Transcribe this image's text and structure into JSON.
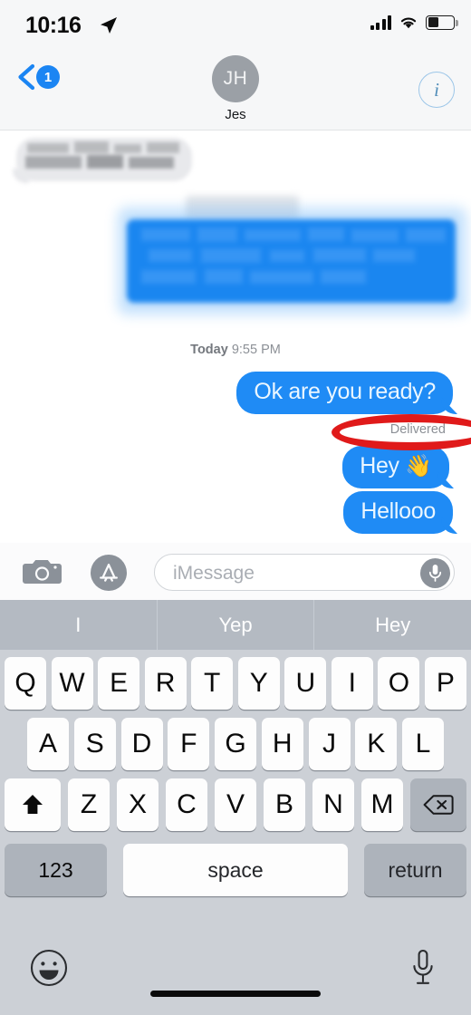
{
  "status_bar": {
    "time": "10:16",
    "location_icon": "location-arrow-icon",
    "signal_icon": "cellular-signal-icon",
    "signal_bars": 4,
    "wifi_icon": "wifi-icon",
    "battery_icon": "battery-icon",
    "battery_level_pct": 38
  },
  "nav_bar": {
    "back_icon": "chevron-left-icon",
    "unread_badge": "1",
    "avatar_initials": "JH",
    "contact_name": "Jes",
    "info_icon": "info-circle-icon",
    "info_letter": "i"
  },
  "conversation": {
    "timestamp_day": "Today",
    "timestamp_time": "9:55 PM",
    "delivered_label": "Delivered",
    "bubble_color": "#1f8bf5",
    "messages": [
      {
        "text": "",
        "side": "received",
        "redacted": true
      },
      {
        "text": "",
        "side": "sent",
        "redacted": true
      },
      {
        "text": "Ok are you ready?",
        "side": "sent",
        "redacted": false
      },
      {
        "text": "Hey",
        "emoji": "👋",
        "side": "sent",
        "redacted": false
      },
      {
        "text": "Hellooo",
        "side": "sent",
        "redacted": false
      }
    ],
    "annotation": {
      "shape": "ellipse",
      "color": "#e01a1a",
      "targets": "Delivered"
    }
  },
  "input_bar": {
    "camera_icon": "camera-icon",
    "app_store_icon": "app-store-icon",
    "placeholder": "iMessage",
    "value": "",
    "mic_icon": "microphone-icon"
  },
  "predictive_bar": {
    "suggestions": [
      "I",
      "Yep",
      "Hey"
    ]
  },
  "keyboard": {
    "row1": [
      "Q",
      "W",
      "E",
      "R",
      "T",
      "Y",
      "U",
      "I",
      "O",
      "P"
    ],
    "row2": [
      "A",
      "S",
      "D",
      "F",
      "G",
      "H",
      "J",
      "K",
      "L"
    ],
    "row3": [
      "Z",
      "X",
      "C",
      "V",
      "B",
      "N",
      "M"
    ],
    "shift_icon": "shift-arrow-icon",
    "delete_icon": "backspace-icon",
    "numbers_label": "123",
    "space_label": "space",
    "return_label": "return"
  },
  "bottom_bar": {
    "emoji_icon": "smiley-face-icon",
    "dictation_icon": "microphone-icon",
    "home_indicator": "home-indicator"
  }
}
